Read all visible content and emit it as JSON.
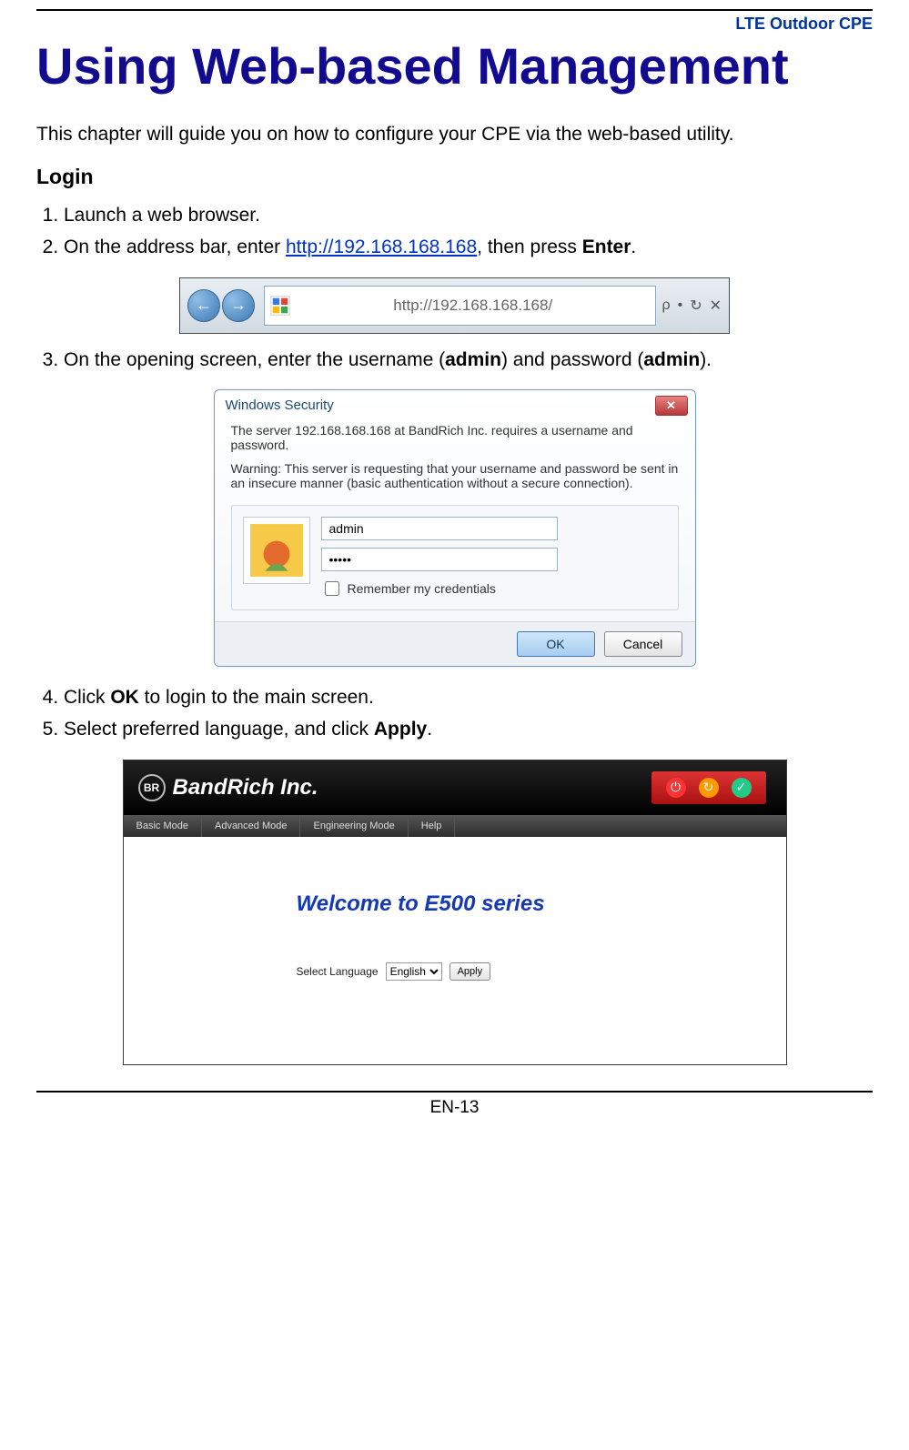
{
  "header": {
    "doc_title": "LTE Outdoor CPE"
  },
  "chapter": {
    "title": "Using Web-based Management"
  },
  "intro": "This chapter will guide you on how to configure your CPE via the web-based utility.",
  "section_login": "Login",
  "steps": {
    "s1": "Launch a web browser.",
    "s2_pre": "On the address bar, enter ",
    "s2_link": "http://192.168.168.168",
    "s2_mid": ", then press ",
    "s2_bold": "Enter",
    "s2_post": ".",
    "s3_pre": "On the opening screen, enter the username (",
    "s3_user": "admin",
    "s3_mid": ") and password (",
    "s3_pass": "admin",
    "s3_post": ").",
    "s4_pre": "Click ",
    "s4_bold": "OK",
    "s4_post": " to login to the main screen.",
    "s5_pre": "Select preferred language, and click ",
    "s5_bold": "Apply",
    "s5_post": "."
  },
  "address_bar": {
    "url": "http://192.168.168.168/",
    "tool_search": "ρ",
    "tool_refresh": "↻",
    "tool_close": "✕"
  },
  "dialog": {
    "title": "Windows Security",
    "msg1": "The server 192.168.168.168 at BandRich Inc. requires a username and password.",
    "msg2": "Warning: This server is requesting that your username and password be sent in an insecure manner (basic authentication without a secure connection).",
    "username_value": "admin",
    "password_value": "•••••",
    "remember_label": "Remember my credentials",
    "ok": "OK",
    "cancel": "Cancel"
  },
  "bandrich": {
    "brand": "BandRich Inc.",
    "menu": [
      "Basic Mode",
      "Advanced Mode",
      "Engineering Mode",
      "Help"
    ],
    "welcome": "Welcome to E500 series",
    "select_label": "Select Language",
    "select_value": "English",
    "apply": "Apply"
  },
  "footer": {
    "page_number": "EN-13"
  }
}
